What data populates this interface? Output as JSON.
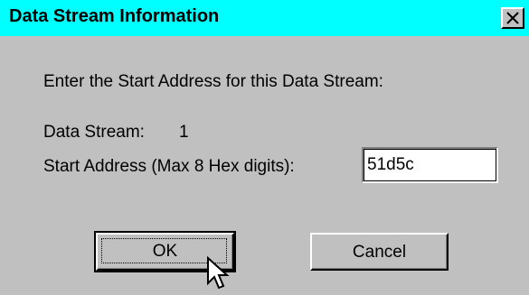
{
  "window": {
    "title": "Data Stream Information",
    "title_bar_color": "#00ffff",
    "close_icon": "close-x-icon"
  },
  "content": {
    "prompt": "Enter the Start Address for this Data Stream:",
    "data_stream_label": "Data Stream:",
    "data_stream_value": "1",
    "start_address_label": "Start Address (Max 8 Hex digits):",
    "start_address_value": "51d5c"
  },
  "buttons": {
    "ok_label": "OK",
    "cancel_label": "Cancel"
  },
  "cursor": {
    "icon": "mouse-pointer-icon"
  }
}
